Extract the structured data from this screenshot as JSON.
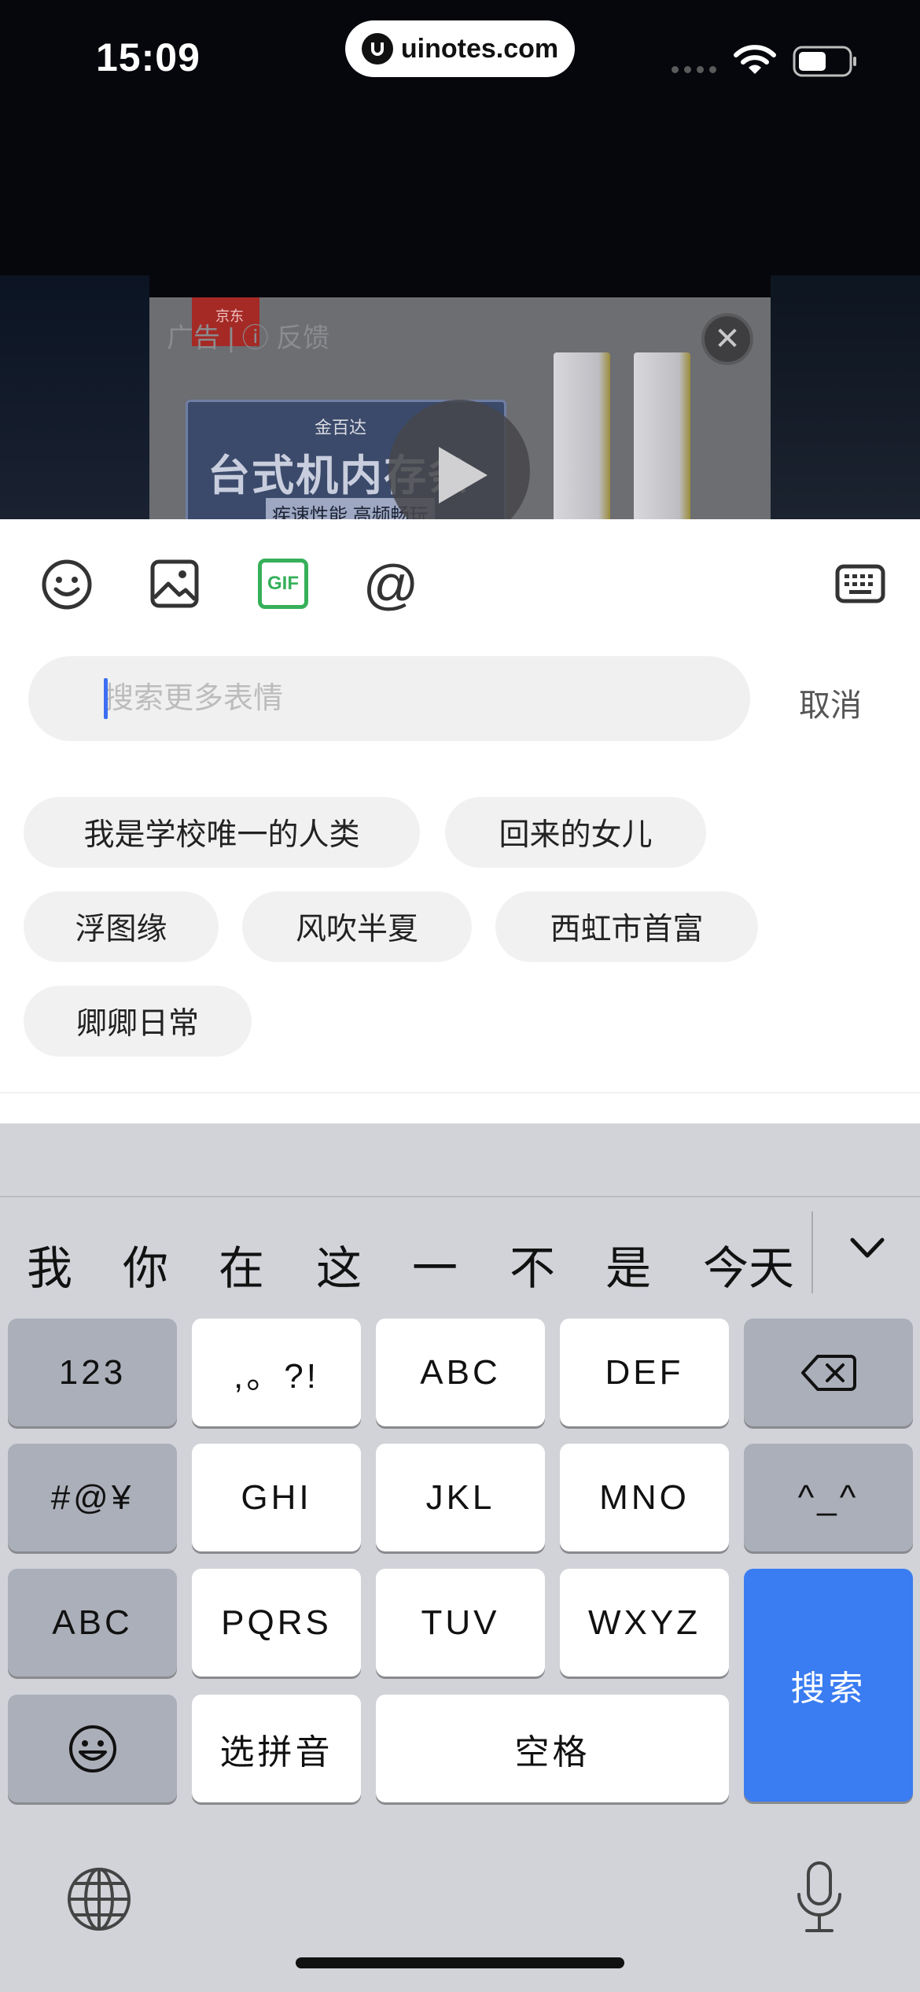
{
  "status_bar": {
    "time": "15:09",
    "site": "uinotes.com"
  },
  "ad": {
    "label": "广告 | ⓘ 反馈",
    "jd_tag": "京东",
    "brand": "金百达",
    "title": "台式机内存条",
    "subtitle": "疾速性能 高频畅玩",
    "close_glyph": "✕"
  },
  "toolbar": {
    "emoji_tab": "smile-icon",
    "image_tab": "image-icon",
    "gif_tab": "GIF",
    "at_tab": "@",
    "keyboard_toggle": "keyboard-icon",
    "accent_color": "#36b05a"
  },
  "search": {
    "placeholder": "搜索更多表情",
    "value": "",
    "cancel_label": "取消"
  },
  "suggestions": [
    "我是学校唯一的人类",
    "回来的女儿",
    "浮图缘",
    "风吹半夏",
    "西虹市首富",
    "卿卿日常"
  ],
  "keyboard": {
    "candidates": [
      "我",
      "你",
      "在",
      "这",
      "一",
      "不",
      "是",
      "今天"
    ],
    "keys": {
      "num": "123",
      "punct": ",。?!",
      "abc": "ABC",
      "def": "DEF",
      "symbols": "#@¥",
      "ghi": "GHI",
      "jkl": "JKL",
      "mno": "MNO",
      "kaomoji": "^_^",
      "abc_switch": "ABC",
      "pqrs": "PQRS",
      "tuv": "TUV",
      "wxyz": "WXYZ",
      "search": "搜索",
      "pinyin": "选拼音",
      "space": "空格"
    },
    "search_key_color": "#3a7cf1"
  }
}
